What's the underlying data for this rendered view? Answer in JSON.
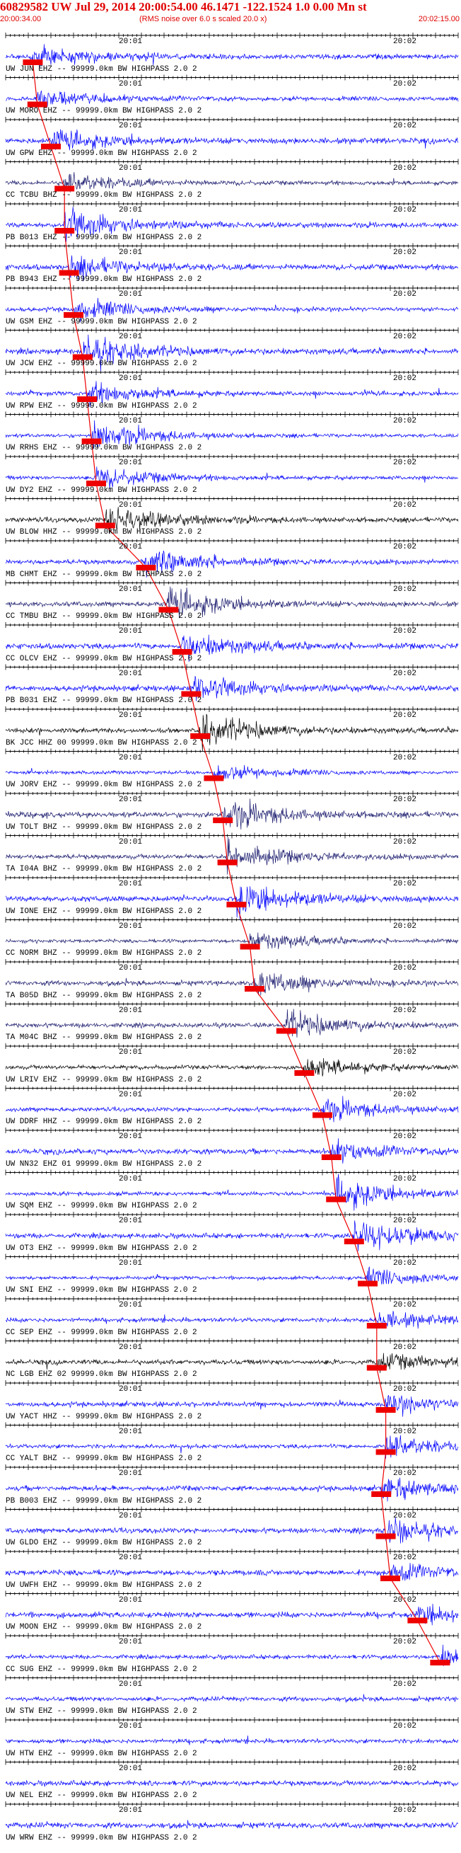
{
  "header": {
    "title": "60829582 UW Jul 29, 2014 20:00:54.00   46.1471 -122.1524   1.0 0.00 Mn st",
    "start_time": "20:00:34.00",
    "rms_note": "(RMS noise over 6.0 s scaled 20.0 x)",
    "end_time": "20:02:15.00"
  },
  "markers": {
    "m1": "20:01",
    "m2": "20:02"
  },
  "colors": {
    "blue": "#0000ff",
    "navy": "#1a1a6e",
    "black": "#000000",
    "pick": "#ee0000",
    "axis": "#000000"
  },
  "traces": [
    {
      "label": "UW JUN EHZ -- 99999.0km BW  HIGHPASS  2.0  2",
      "color": "blue",
      "pick": 0.06
    },
    {
      "label": "UW MORO EHZ -- 99999.0km BW  HIGHPASS  2.0  2",
      "color": "blue",
      "pick": 0.07
    },
    {
      "label": "UW GPW EHZ -- 99999.0km BW  HIGHPASS  2.0  2",
      "color": "blue",
      "pick": 0.1
    },
    {
      "label": "CC TCBU BHZ -- 99999.0km BW  HIGHPASS  2.0  2",
      "color": "navy",
      "pick": 0.13
    },
    {
      "label": "PB B013 EHZ -- 99999.0km BW  HIGHPASS  2.0  2",
      "color": "blue",
      "pick": 0.13
    },
    {
      "label": "PB B943 EHZ -- 99999.0km BW  HIGHPASS  2.0  2",
      "color": "blue",
      "pick": 0.14
    },
    {
      "label": "UW GSM EHZ -- 99999.0km BW  HIGHPASS  2.0  2",
      "color": "blue",
      "pick": 0.15
    },
    {
      "label": "UW JCW EHZ -- 99999.0km BW  HIGHPASS  2.0  2",
      "color": "blue",
      "pick": 0.17
    },
    {
      "label": "UW RPW EHZ -- 99999.0km BW  HIGHPASS  2.0  2",
      "color": "blue",
      "pick": 0.18
    },
    {
      "label": "UW RRHS EHZ -- 99999.0km BW  HIGHPASS  2.0  2",
      "color": "blue",
      "pick": 0.19
    },
    {
      "label": "UW DY2 EHZ -- 99999.0km BW  HIGHPASS  2.0  2",
      "color": "blue",
      "pick": 0.2
    },
    {
      "label": "UW BLOW HHZ -- 99999.0km BW  HIGHPASS  2.0  2",
      "color": "black",
      "pick": 0.22
    },
    {
      "label": "MB CHMT EHZ -- 99999.0km BW  HIGHPASS  2.0  2",
      "color": "blue",
      "pick": 0.31
    },
    {
      "label": "CC TMBU BHZ -- 99999.0km BW  HIGHPASS  2.0  2",
      "color": "navy",
      "pick": 0.36
    },
    {
      "label": "CC OLCV EHZ -- 99999.0km BW  HIGHPASS  2.0  2",
      "color": "blue",
      "pick": 0.39
    },
    {
      "label": "PB B031 EHZ -- 99999.0km BW  HIGHPASS  2.0  2",
      "color": "blue",
      "pick": 0.41
    },
    {
      "label": "BK JCC HHZ 00 99999.0km BW  HIGHPASS  2.0  2",
      "color": "black",
      "pick": 0.43
    },
    {
      "label": "UW JORV EHZ -- 99999.0km BW  HIGHPASS  2.0  2",
      "color": "blue",
      "pick": 0.46
    },
    {
      "label": "UW TOLT BHZ -- 99999.0km BW  HIGHPASS  2.0  2",
      "color": "navy",
      "pick": 0.48
    },
    {
      "label": "TA I04A BHZ -- 99999.0km BW  HIGHPASS  2.0  2",
      "color": "navy",
      "pick": 0.49
    },
    {
      "label": "UW IONE EHZ -- 99999.0km BW  HIGHPASS  2.0  2",
      "color": "blue",
      "pick": 0.51
    },
    {
      "label": "CC NORM BHZ -- 99999.0km BW  HIGHPASS  2.0  2",
      "color": "navy",
      "pick": 0.54
    },
    {
      "label": "TA B05D BHZ -- 99999.0km BW  HIGHPASS  2.0  2",
      "color": "navy",
      "pick": 0.55
    },
    {
      "label": "TA M04C BHZ -- 99999.0km BW  HIGHPASS  2.0  2",
      "color": "navy",
      "pick": 0.62
    },
    {
      "label": "UW LRIV EHZ -- 99999.0km BW  HIGHPASS  2.0  2",
      "color": "black",
      "pick": 0.66
    },
    {
      "label": "UW DDRF HHZ -- 99999.0km BW  HIGHPASS  2.0  2",
      "color": "blue",
      "pick": 0.7
    },
    {
      "label": "UW NN32 EHZ 01 99999.0km BW  HIGHPASS  2.0  2",
      "color": "blue",
      "pick": 0.72
    },
    {
      "label": "UW SQM EHZ -- 99999.0km BW  HIGHPASS  2.0  2",
      "color": "blue",
      "pick": 0.73
    },
    {
      "label": "UW OT3 EHZ -- 99999.0km BW  HIGHPASS  2.0  2",
      "color": "blue",
      "pick": 0.77
    },
    {
      "label": "UW SNI EHZ -- 99999.0km BW  HIGHPASS  2.0  2",
      "color": "blue",
      "pick": 0.8
    },
    {
      "label": "CC SEP EHZ -- 99999.0km BW  HIGHPASS  2.0  2",
      "color": "blue",
      "pick": 0.82
    },
    {
      "label": "NC LGB EHZ 02 99999.0km BW  HIGHPASS  2.0  2",
      "color": "black",
      "pick": 0.82
    },
    {
      "label": "UW YACT HHZ -- 99999.0km BW  HIGHPASS  2.0  2",
      "color": "blue",
      "pick": 0.84
    },
    {
      "label": "CC YALT BHZ -- 99999.0km BW  HIGHPASS  2.0  2",
      "color": "blue",
      "pick": 0.84
    },
    {
      "label": "PB B003 EHZ -- 99999.0km BW  HIGHPASS  2.0  2",
      "color": "blue",
      "pick": 0.83
    },
    {
      "label": "UW GLDO EHZ -- 99999.0km BW  HIGHPASS  2.0  2",
      "color": "blue",
      "pick": 0.84
    },
    {
      "label": "UW UWFH EHZ -- 99999.0km BW  HIGHPASS  2.0  2",
      "color": "blue",
      "pick": 0.85
    },
    {
      "label": "UW MOON EHZ -- 99999.0km BW  HIGHPASS  2.0  2",
      "color": "blue",
      "pick": 0.91
    },
    {
      "label": "CC SUG EHZ -- 99999.0km BW  HIGHPASS  2.0  2",
      "color": "blue",
      "pick": 0.96
    },
    {
      "label": "UW STW EHZ -- 99999.0km BW  HIGHPASS  2.0  2",
      "color": "blue",
      "pick": null
    },
    {
      "label": "UW HTW EHZ -- 99999.0km BW  HIGHPASS  2.0  2",
      "color": "blue",
      "pick": null
    },
    {
      "label": "UW NEL EHZ -- 99999.0km BW  HIGHPASS  2.0  2",
      "color": "blue",
      "pick": null
    },
    {
      "label": "UW WRW EHZ -- 99999.0km BW  HIGHPASS  2.0  2",
      "color": "blue",
      "pick": null
    }
  ]
}
